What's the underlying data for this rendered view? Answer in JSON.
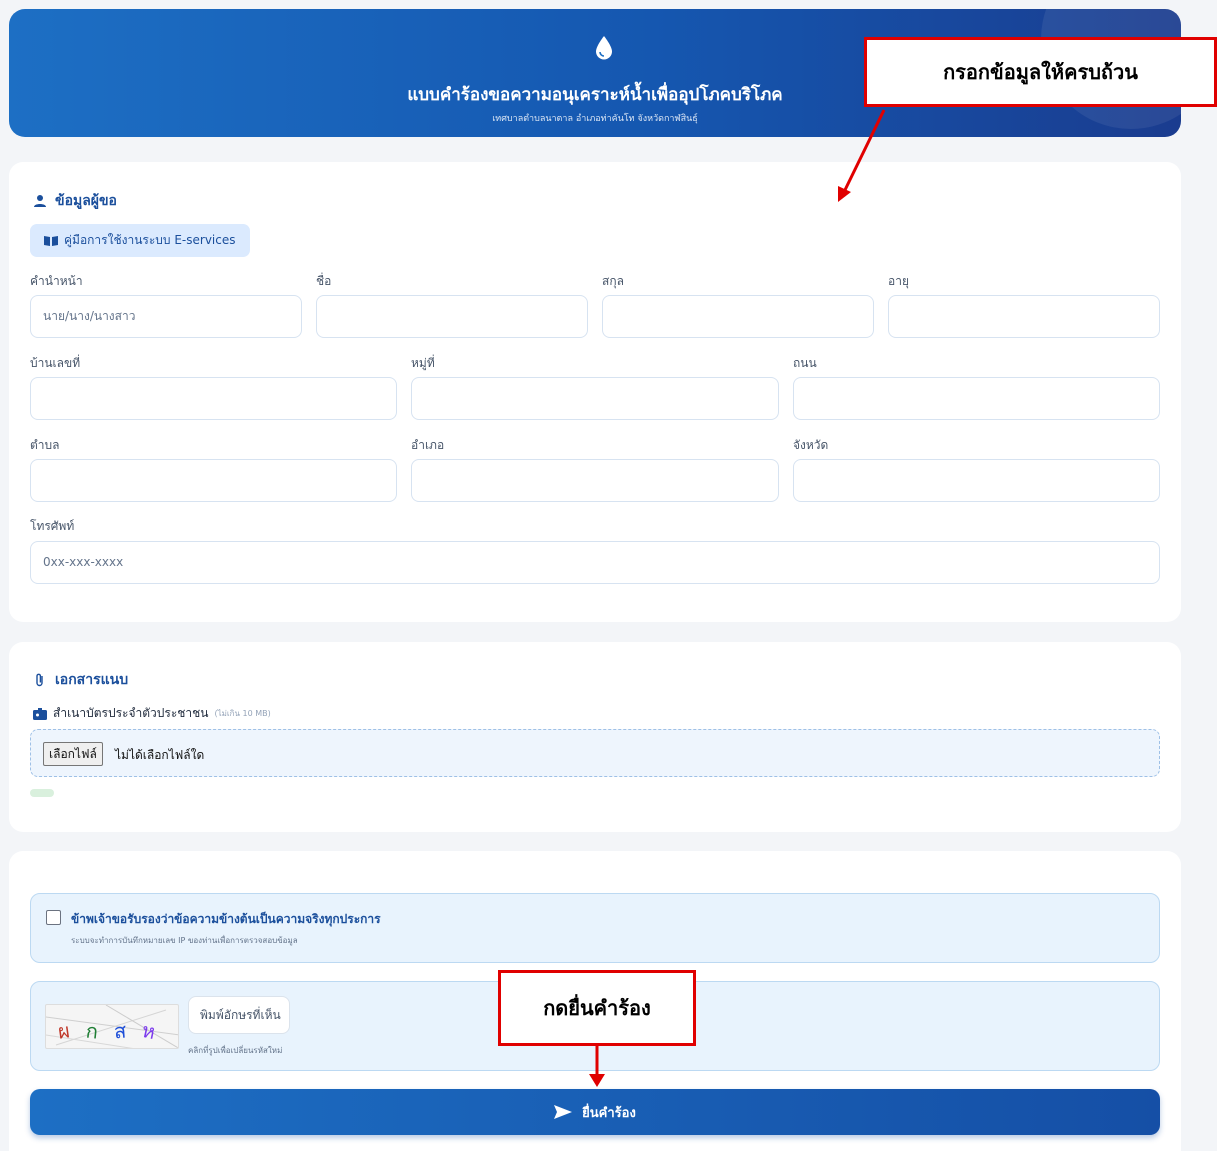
{
  "header": {
    "title": "แบบคำร้องขอความอนุเคราะห์น้ำเพื่ออุปโภคบริโภค",
    "subtitle": "เทศบาลตำบลนาตาล อำเภอท่าคันโท จังหวัดกาฬสินธุ์"
  },
  "applicant": {
    "section_title": "ข้อมูลผู้ขอ",
    "guide_button": "คู่มือการใช้งานระบบ E-services",
    "fields": {
      "prefix": {
        "label": "คำนำหน้า",
        "placeholder": "นาย/นาง/นางสาว"
      },
      "first_name": {
        "label": "ชื่อ",
        "placeholder": ""
      },
      "last_name": {
        "label": "สกุล",
        "placeholder": ""
      },
      "age": {
        "label": "อายุ",
        "placeholder": ""
      },
      "house_no": {
        "label": "บ้านเลขที่",
        "placeholder": ""
      },
      "moo": {
        "label": "หมู่ที่",
        "placeholder": ""
      },
      "road": {
        "label": "ถนน",
        "placeholder": ""
      },
      "subdistrict": {
        "label": "ตำบล",
        "placeholder": ""
      },
      "district": {
        "label": "อำเภอ",
        "placeholder": ""
      },
      "province": {
        "label": "จังหวัด",
        "placeholder": ""
      },
      "phone": {
        "label": "โทรศัพท์",
        "placeholder": "0xx-xxx-xxxx"
      }
    }
  },
  "attachments": {
    "section_title": "เอกสารแนบ",
    "id_card_label": "สำเนาบัตรประจำตัวประชาชน",
    "id_card_limit": "(ไม่เกิน 10 MB)",
    "choose_file": "เลือกไฟล์",
    "no_file": "ไม่ได้เลือกไฟล์ใด"
  },
  "confirm": {
    "text": "ข้าพเจ้าขอรับรองว่าข้อความข้างต้นเป็นความจริงทุกประการ",
    "note": "ระบบจะทำการบันทึกหมายเลข IP ของท่านเพื่อการตรวจสอบข้อมูล",
    "checked": false
  },
  "captcha": {
    "chars": [
      "ผ",
      "ก",
      "ส",
      "ห"
    ],
    "colors": [
      "#c0392b",
      "#1e7e34",
      "#1d4ed8",
      "#7c3aed"
    ],
    "input_placeholder": "พิมพ์อักษรที่เห็น",
    "hint": "คลิกที่รูปเพื่อเปลี่ยนรหัสใหม่"
  },
  "submit_label": "ยื่นคำร้อง",
  "annotations": {
    "top_callout": "กรอกข้อมูลให้ครบถ้วน",
    "bottom_callout": "กดยื่นคำร้อง",
    "color": "#e00000"
  }
}
